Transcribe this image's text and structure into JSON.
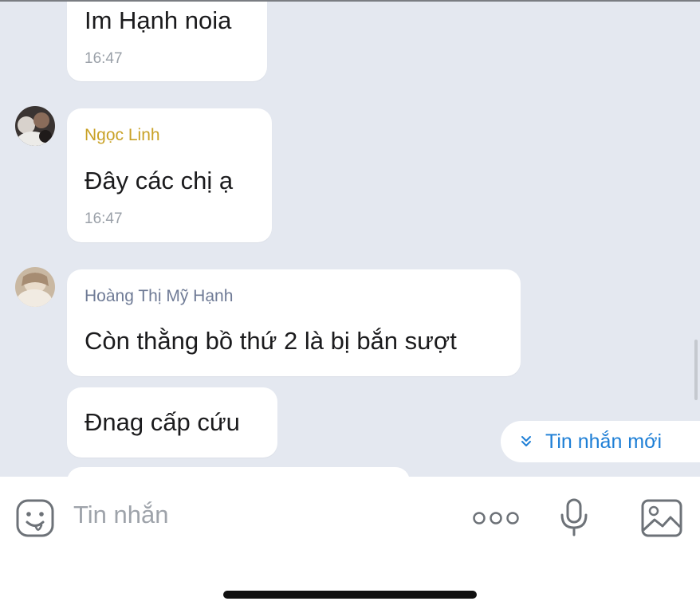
{
  "colors": {
    "chat_background": "#e4e8f0",
    "bubble": "#ffffff",
    "sender_ngoc_linh": "#c9a227",
    "sender_hoang_thi_my_hanh": "#6f7b96",
    "accent": "#1e7fd6",
    "timestamp": "#9aa0a8"
  },
  "messages": [
    {
      "text": "Im Hạnh noia",
      "time": "16:47"
    },
    {
      "sender": "Ngọc Linh",
      "text": "Đây các chị ạ",
      "time": "16:47",
      "avatar": "avatar-photo"
    },
    {
      "sender": "Hoàng Thị Mỹ Hạnh",
      "text": "Còn thằng bồ thứ 2 là bị bắn sượt",
      "avatar": "avatar-photo"
    },
    {
      "text": "Đnag cấp cứu"
    }
  ],
  "new_messages_button": {
    "label": "Tin nhắn mới",
    "icon": "double-chevron-down-icon"
  },
  "composer": {
    "placeholder": "Tin nhắn",
    "icons": [
      "emoji-sticker-icon",
      "more-dots-icon",
      "microphone-icon",
      "image-icon"
    ]
  }
}
